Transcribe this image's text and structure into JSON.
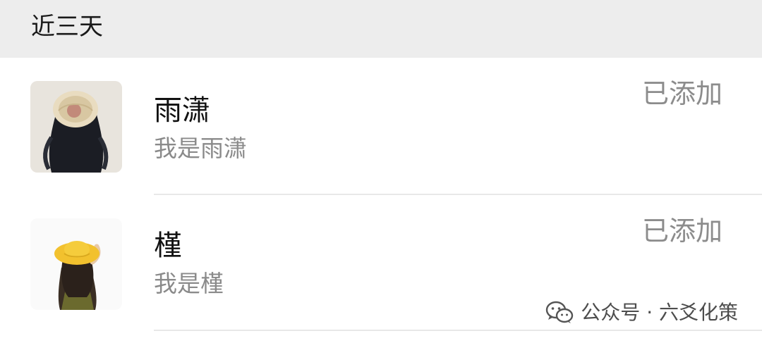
{
  "section": {
    "title": "近三天"
  },
  "contacts": [
    {
      "name": "雨潇",
      "message": "我是雨潇",
      "status": "已添加",
      "avatar_icon": "avatar-girl-dark-hair-icon"
    },
    {
      "name": "槿",
      "message": "我是槿",
      "status": "已添加",
      "avatar_icon": "avatar-girl-yellow-hat-icon"
    }
  ],
  "watermark": {
    "text": "公众号 · 六爻化策",
    "icon": "wechat-icon"
  },
  "colors": {
    "header_bg": "#ededed",
    "status_text": "#8c8c8c",
    "hat_yellow": "#f2c12e"
  }
}
